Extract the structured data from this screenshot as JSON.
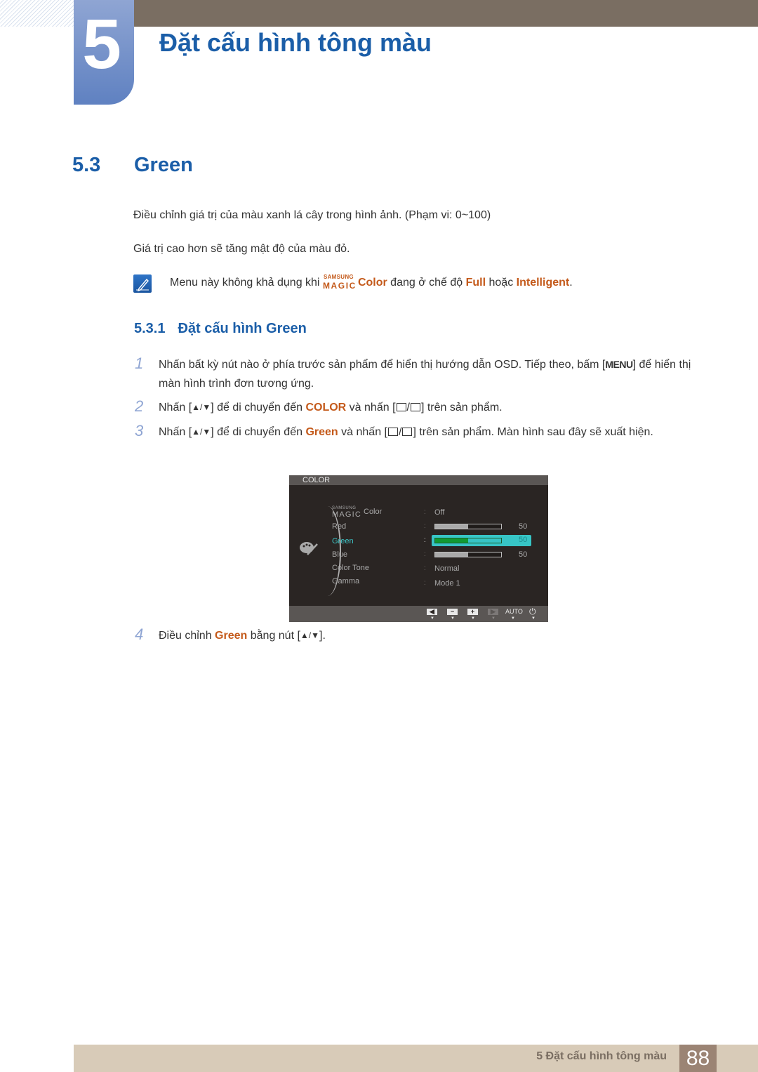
{
  "chapter": {
    "number": "5",
    "title": "Đặt cấu hình tông màu"
  },
  "section": {
    "number": "5.3",
    "title": "Green"
  },
  "paragraphs": [
    "Điều chỉnh giá trị của màu xanh lá cây trong hình ảnh. (Phạm vi: 0~100)",
    "Giá trị cao hơn sẽ tăng mật độ của màu đỏ."
  ],
  "note": {
    "icon": "note-pencil-icon",
    "prefix": "Menu này không khả dụng khi ",
    "magic_small": "SAMSUNG",
    "magic_big": "MAGIC",
    "magic_word": "Color",
    "middle": " đang ở chế độ ",
    "opt1": "Full",
    "or": " hoặc ",
    "opt2": "Intelligent",
    "end": "."
  },
  "subsection": {
    "number": "5.3.1",
    "title": "Đặt cấu hình Green"
  },
  "steps": [
    {
      "num": "1",
      "text_a": "Nhấn bất kỳ nút nào ở phía trước sản phẩm để hiển thị hướng dẫn OSD. Tiếp theo, bấm [",
      "key": "MENU",
      "text_b": "] để hiển thị màn hình trình đơn tương ứng."
    },
    {
      "num": "2",
      "text_a": "Nhấn [",
      "arrows": "▲/▼",
      "text_b": "] để di chuyển đến ",
      "target": "COLOR",
      "text_c": " và nhấn [",
      "text_d": "] trên sản phẩm."
    },
    {
      "num": "3",
      "text_a": "Nhấn [",
      "arrows": "▲/▼",
      "text_b": "] để di chuyển đến ",
      "target": "Green",
      "text_c": " và nhấn [",
      "text_d": "] trên sản phẩm. Màn hình sau đây sẽ xuất hiện."
    },
    {
      "num": "4",
      "text_a": "Điều chỉnh ",
      "target": "Green",
      "text_b": " bằng nút [",
      "arrows": "▲/▼",
      "text_c": "]."
    }
  ],
  "osd": {
    "title": "COLOR",
    "icon": "palette-icon",
    "magic_small": "SAMSUNG",
    "magic_big": "MAGIC",
    "magic_word": "Color",
    "items": [
      {
        "label": "Red",
        "value_percent": 50,
        "value": "50"
      },
      {
        "label": "Green",
        "value_percent": 50,
        "value": "50",
        "active": true
      },
      {
        "label": "Blue",
        "value_percent": 50,
        "value": "50"
      },
      {
        "label": "Color Tone",
        "value": "Normal"
      },
      {
        "label": "Gamma",
        "value": "Mode 1"
      }
    ],
    "magic_value": "Off",
    "colon": ":",
    "footer": {
      "buttons": [
        "left-arrow-icon",
        "minus-icon",
        "plus-icon",
        "right-arrow-icon",
        "AUTO",
        "power-icon"
      ],
      "auto_label": "AUTO"
    }
  },
  "footer": {
    "text": "5 Đặt cấu hình tông màu",
    "page": "88"
  }
}
